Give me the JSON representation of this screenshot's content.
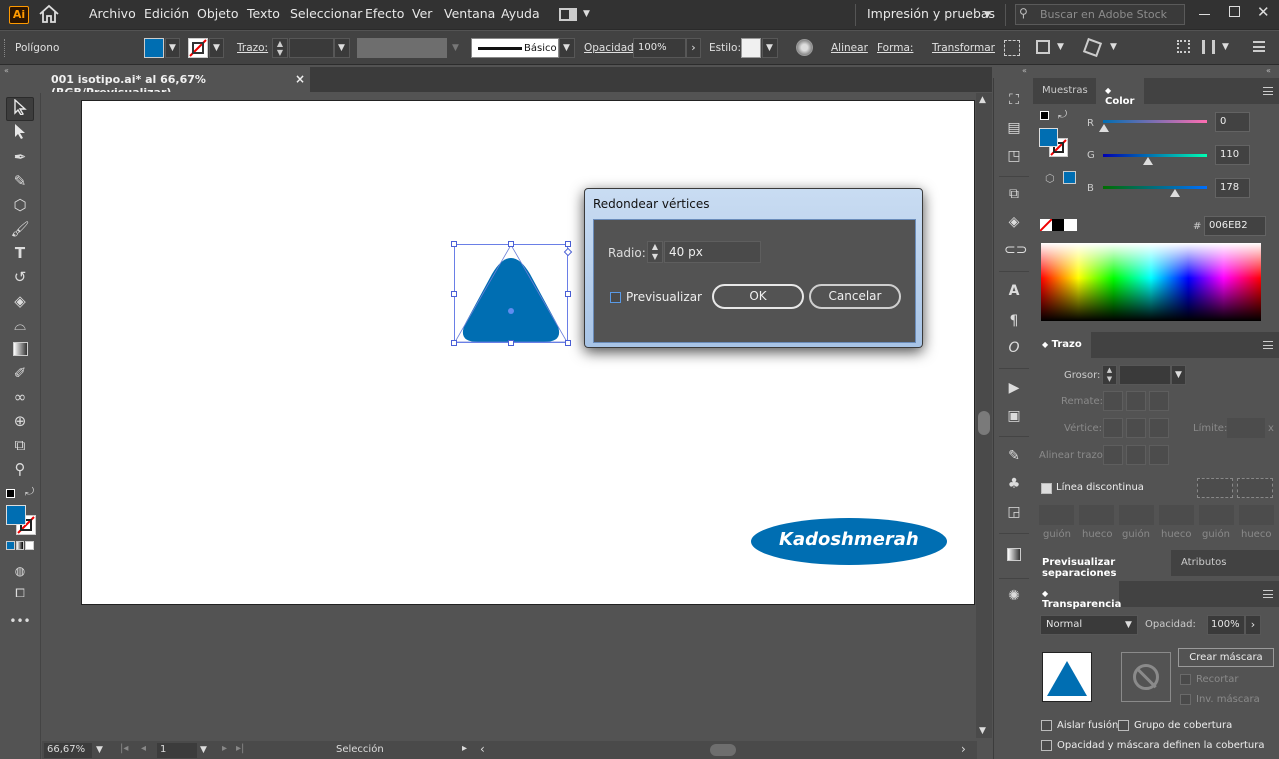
{
  "menu": {
    "items": [
      "Archivo",
      "Edición",
      "Objeto",
      "Texto",
      "Seleccionar",
      "Efecto",
      "Ver",
      "Ventana",
      "Ayuda"
    ],
    "workspace": "Impresión y pruebas",
    "search_placeholder": "Buscar en Adobe Stock",
    "logo": "Ai"
  },
  "control": {
    "selection": "Polígono",
    "stroke_label": "Trazo:",
    "style_name": "Básico",
    "opacity_label": "Opacidad:",
    "opacity_value": "100%",
    "style_label": "Estilo:",
    "align_label": "Alinear",
    "shape_label": "Forma:",
    "transform_label": "Transformar",
    "fill_color": "#006EB2"
  },
  "document": {
    "tab_title": "001 isotipo.ai* al 66,67% (RGB/Previsualizar)",
    "close": "×"
  },
  "canvas": {
    "logo_text": "Kadoshmerah",
    "logo_color": "#006EB2",
    "shape_color": "#006EB2"
  },
  "dialog": {
    "title": "Redondear vértices",
    "radius_label": "Radio:",
    "radius_value": "40 px",
    "preview_label": "Previsualizar",
    "ok": "OK",
    "cancel": "Cancelar"
  },
  "status": {
    "zoom": "66,67%",
    "page": "1",
    "mode": "Selección"
  },
  "color_panel": {
    "tabs": [
      "Muestras",
      "Color"
    ],
    "r_label": "R",
    "r_value": "0",
    "g_label": "G",
    "g_value": "110",
    "b_label": "B",
    "b_value": "178",
    "hex_label": "#",
    "hex_value": "006EB2",
    "r": 0,
    "g": 110,
    "b": 178
  },
  "stroke_panel": {
    "title": "Trazo",
    "weight_label": "Grosor:",
    "cap_label": "Remate:",
    "corner_label": "Vértice:",
    "limit_label": "Límite:",
    "limit_suffix": "x",
    "align_label": "Alinear trazo:",
    "dashed_label": "Línea discontinua",
    "dash_labels": [
      "guión",
      "hueco",
      "guión",
      "hueco",
      "guión",
      "hueco"
    ]
  },
  "sep_panel": {
    "tabs": [
      "Previsualizar separaciones",
      "Atributos"
    ]
  },
  "transparency_panel": {
    "title": "Transparencia",
    "blend_mode": "Normal",
    "opacity_label": "Opacidad:",
    "opacity_value": "100%",
    "make_mask": "Crear máscara",
    "clip": "Recortar",
    "invert": "Inv. máscara",
    "isolate": "Aislar fusión",
    "knockout": "Grupo de cobertura",
    "opacity_mask": "Opacidad y máscara definen la cobertura"
  }
}
